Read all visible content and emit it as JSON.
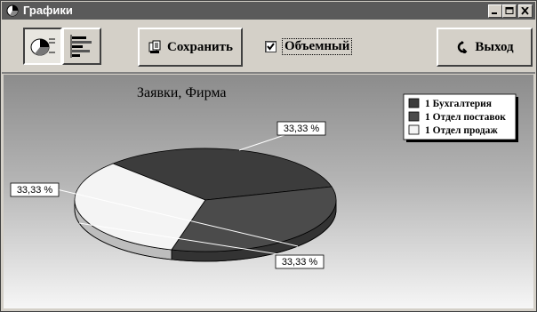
{
  "window": {
    "title": "Графики"
  },
  "toolbar": {
    "pie_view_icon": "pie-chart-icon",
    "bar_view_icon": "bar-chart-icon",
    "save_label": "Сохранить",
    "save_icon": "save-icon",
    "three_d_label": "Объемный",
    "three_d_checked": true,
    "exit_label": "Выход",
    "exit_icon": "exit-icon"
  },
  "colors": {
    "slice1": "#3c3c3c",
    "slice2": "#4b4b4b",
    "slice3": "#f4f4f4"
  },
  "chart_data": {
    "type": "pie",
    "title": "Заявки, Фирма",
    "three_d": true,
    "legend_position": "top-right",
    "slices": [
      {
        "label": "1 Бухгалтерия",
        "value": 33.33,
        "data_label": "33,33 %"
      },
      {
        "label": "1 Отдел поставок",
        "value": 33.33,
        "data_label": "33,33 %"
      },
      {
        "label": "1 Отдел продаж",
        "value": 33.33,
        "data_label": "33,33 %"
      }
    ]
  }
}
